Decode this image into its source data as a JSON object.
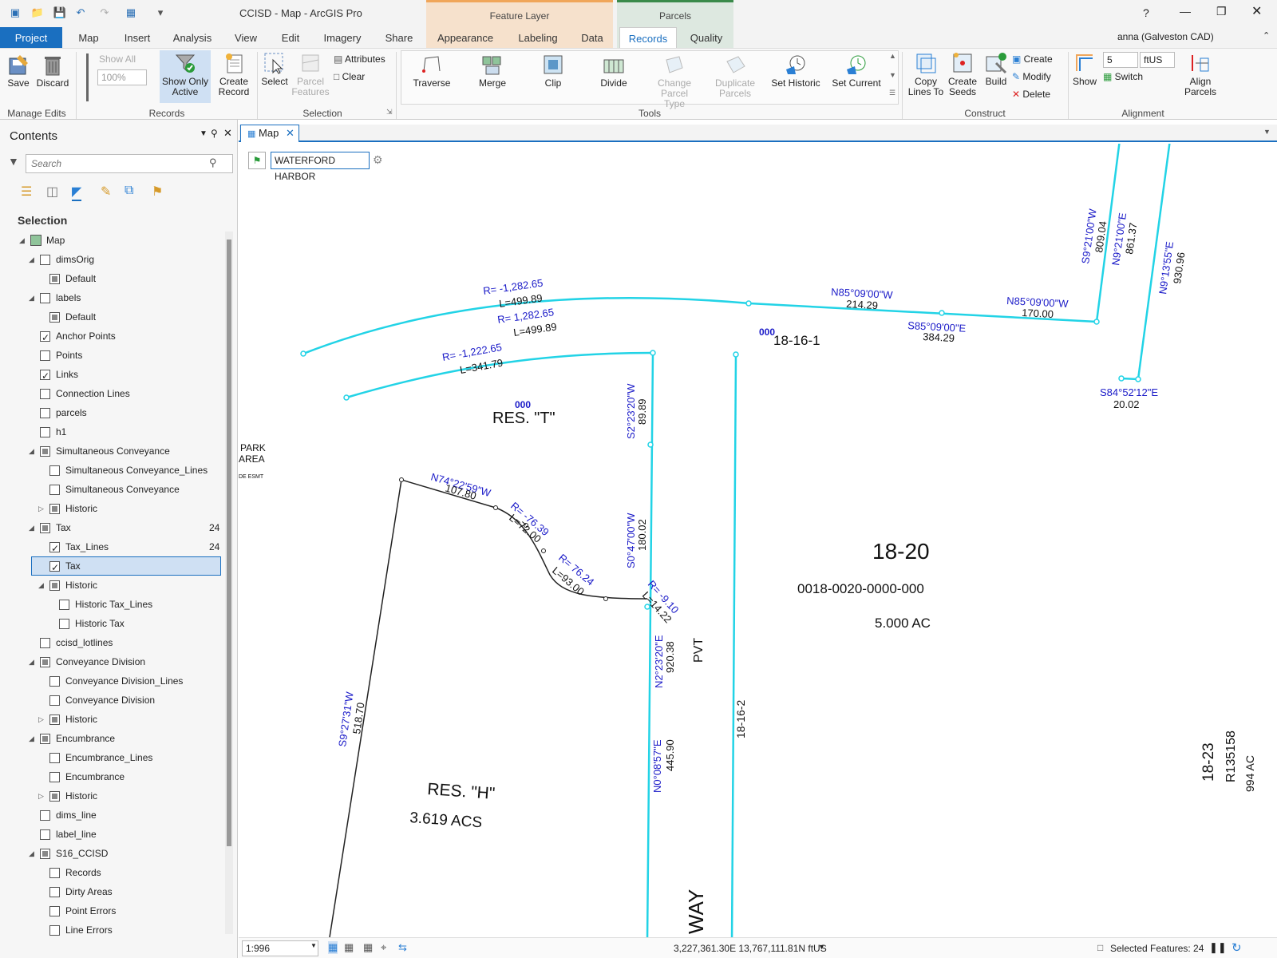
{
  "window": {
    "title": "CCISD - Map - ArcGIS Pro",
    "user": "anna (Galveston CAD)"
  },
  "context_headers": {
    "feature_layer": "Feature Layer",
    "parcels": "Parcels"
  },
  "tabs": [
    "Project",
    "Map",
    "Insert",
    "Analysis",
    "View",
    "Edit",
    "Imagery",
    "Share",
    "Appearance",
    "Labeling",
    "Data",
    "Records",
    "Quality"
  ],
  "ribbon": {
    "manage_edits": {
      "save": "Save",
      "discard": "Discard",
      "group": "Manage Edits"
    },
    "records": {
      "show_all": "Show All",
      "zoom": "100%",
      "show_only_active": "Show Only Active",
      "create_record": "Create Record",
      "group": "Records"
    },
    "selection": {
      "select": "Select",
      "parcel_features": "Parcel Features",
      "attributes": "Attributes",
      "clear": "Clear",
      "group": "Selection"
    },
    "tools": {
      "traverse": "Traverse",
      "merge": "Merge",
      "clip": "Clip",
      "divide": "Divide",
      "change_parcel_type": "Change Parcel Type",
      "duplicate_parcels": "Duplicate Parcels",
      "set_historic": "Set Historic",
      "set_current": "Set Current",
      "group": "Tools"
    },
    "construct": {
      "copy_lines_to": "Copy Lines To",
      "create_seeds": "Create Seeds",
      "build": "Build",
      "create": "Create",
      "modify": "Modify",
      "delete": "Delete",
      "group": "Construct"
    },
    "alignment": {
      "show": "Show",
      "value": "5",
      "unit": "ftUS",
      "switch": "Switch",
      "align_parcels": "Align Parcels",
      "group": "Alignment"
    }
  },
  "contents": {
    "title": "Contents",
    "search_placeholder": "Search",
    "section": "Selection",
    "items": [
      {
        "label": "Map",
        "level": 0,
        "cb": "none",
        "exp": "open"
      },
      {
        "label": "dimsOrig",
        "level": 1,
        "cb": "off",
        "exp": "open"
      },
      {
        "label": "Default",
        "level": 2,
        "cb": "part",
        "exp": "none"
      },
      {
        "label": "labels",
        "level": 1,
        "cb": "off",
        "exp": "open"
      },
      {
        "label": "Default",
        "level": 2,
        "cb": "part",
        "exp": "none"
      },
      {
        "label": "Anchor Points",
        "level": 1,
        "cb": "on",
        "exp": "none"
      },
      {
        "label": "Points",
        "level": 1,
        "cb": "off",
        "exp": "none"
      },
      {
        "label": "Links",
        "level": 1,
        "cb": "on",
        "exp": "none"
      },
      {
        "label": "Connection Lines",
        "level": 1,
        "cb": "off",
        "exp": "none"
      },
      {
        "label": "parcels",
        "level": 1,
        "cb": "off",
        "exp": "none"
      },
      {
        "label": "h1",
        "level": 1,
        "cb": "off",
        "exp": "none"
      },
      {
        "label": "Simultaneous Conveyance",
        "level": 1,
        "cb": "part",
        "exp": "open"
      },
      {
        "label": "Simultaneous Conveyance_Lines",
        "level": 2,
        "cb": "off",
        "exp": "none"
      },
      {
        "label": "Simultaneous Conveyance",
        "level": 2,
        "cb": "off",
        "exp": "none"
      },
      {
        "label": "Historic",
        "level": 2,
        "cb": "part",
        "exp": "closed"
      },
      {
        "label": "Tax",
        "level": 1,
        "cb": "part",
        "exp": "open",
        "count": "24"
      },
      {
        "label": "Tax_Lines",
        "level": 2,
        "cb": "on",
        "exp": "none",
        "count": "24"
      },
      {
        "label": "Tax",
        "level": 2,
        "cb": "on",
        "exp": "none",
        "selected": true
      },
      {
        "label": "Historic",
        "level": 2,
        "cb": "part",
        "exp": "open"
      },
      {
        "label": "Historic Tax_Lines",
        "level": 3,
        "cb": "off",
        "exp": "none"
      },
      {
        "label": "Historic Tax",
        "level": 3,
        "cb": "off",
        "exp": "none"
      },
      {
        "label": "ccisd_lotlines",
        "level": 1,
        "cb": "off",
        "exp": "none"
      },
      {
        "label": "Conveyance Division",
        "level": 1,
        "cb": "part",
        "exp": "open"
      },
      {
        "label": "Conveyance Division_Lines",
        "level": 2,
        "cb": "off",
        "exp": "none"
      },
      {
        "label": "Conveyance Division",
        "level": 2,
        "cb": "off",
        "exp": "none"
      },
      {
        "label": "Historic",
        "level": 2,
        "cb": "part",
        "exp": "closed"
      },
      {
        "label": "Encumbrance",
        "level": 1,
        "cb": "part",
        "exp": "open"
      },
      {
        "label": "Encumbrance_Lines",
        "level": 2,
        "cb": "off",
        "exp": "none"
      },
      {
        "label": "Encumbrance",
        "level": 2,
        "cb": "off",
        "exp": "none"
      },
      {
        "label": "Historic",
        "level": 2,
        "cb": "part",
        "exp": "closed"
      },
      {
        "label": "dims_line",
        "level": 1,
        "cb": "off",
        "exp": "none"
      },
      {
        "label": "label_line",
        "level": 1,
        "cb": "off",
        "exp": "none"
      },
      {
        "label": "S16_CCISD",
        "level": 1,
        "cb": "part",
        "exp": "open"
      },
      {
        "label": "Records",
        "level": 2,
        "cb": "off",
        "exp": "none"
      },
      {
        "label": "Dirty Areas",
        "level": 2,
        "cb": "off",
        "exp": "none"
      },
      {
        "label": "Point Errors",
        "level": 2,
        "cb": "off",
        "exp": "none"
      },
      {
        "label": "Line Errors",
        "level": 2,
        "cb": "off",
        "exp": "none"
      }
    ]
  },
  "map": {
    "tab": "Map",
    "active_record": "WATERFORD HARBOR",
    "labels": {
      "r1a": "R= -1,282.65",
      "l1a": "L=499.89",
      "r1b": "R= 1,282.65",
      "l1b": "L=499.89",
      "r2": "R= -1,222.65",
      "l2": "L=341.79",
      "b1": "N85°09'00\"W",
      "d1": "214.29",
      "b2": "S85°09'00\"E",
      "d2": "384.29",
      "b3": "N85°09'00\"W",
      "d3": "170.00",
      "b4": "S9°21'00\"W",
      "d4": "809.04",
      "b5": "N9°21'00\"E",
      "d5": "861.37",
      "b6": "N9°13'55\"E",
      "d6": "930.96",
      "b7": "S84°52'12\"E",
      "d7": "20.02",
      "b8": "S2°23'20\"W",
      "d8": "89.89",
      "b9": "S0°47'00\"W",
      "d9": "180.02",
      "b10": "N2°23'20\"E",
      "d10": "920.38",
      "b11": "N0°08'57\"E",
      "d11": "445.90",
      "b12": "N74°22'59\"W",
      "d12": "107.80",
      "r3": "R= -76.39",
      "l3": "L=72.00",
      "r4": "R= 76.24",
      "l4": "L=93.00",
      "r5": "R= -9.10",
      "l5": "L=14.22",
      "b13": "S9°27'31\"W",
      "d13": "518.70",
      "p1": "18-16-1",
      "p1c": "000",
      "rest": "RES. \"T\"",
      "restc": "000",
      "park1": "PARK",
      "park2": "AREA",
      "esmt": "DE ESMT",
      "p2": "18-20",
      "p2id": "0018-0020-0000-000",
      "p2ac": "5.000 AC",
      "pvt": "PVT",
      "p3": "18-16-2",
      "resh": "RES. \"H\"",
      "resh_ac": "3.619  ACS",
      "way": "WAY",
      "p4": "18-23",
      "p4id": "R135158",
      "p4ac": "994 AC"
    }
  },
  "status": {
    "scale": "1:996",
    "coords": "3,227,361.30E 13,767,111.81N ftUS",
    "selected": "Selected Features: 24"
  }
}
